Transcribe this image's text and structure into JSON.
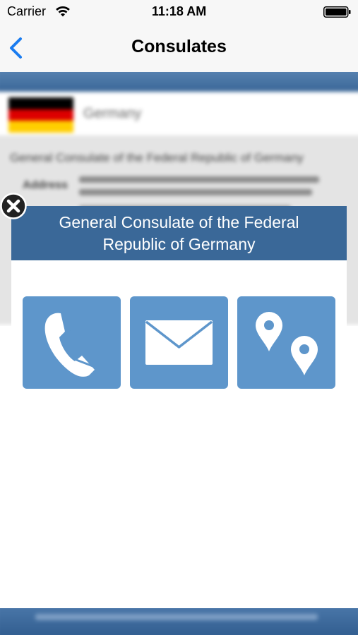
{
  "status_bar": {
    "carrier": "Carrier",
    "time": "11:18 AM",
    "wifi_icon": "wifi-icon",
    "battery_icon": "battery-icon"
  },
  "nav_bar": {
    "back_icon": "chevron-left-icon",
    "title": "Consulates"
  },
  "background": {
    "country_name": "Germany",
    "detail_title": "General Consulate of the Federal Republic of Germany",
    "address_label": "Address"
  },
  "modal": {
    "title": "General Consulate of the Federal Republic of Germany",
    "actions": [
      {
        "name": "call",
        "icon": "phone-icon"
      },
      {
        "name": "email",
        "icon": "mail-icon"
      },
      {
        "name": "map",
        "icon": "map-pins-icon"
      }
    ],
    "close_icon": "close-icon"
  },
  "colors": {
    "accent_blue": "#007aff",
    "modal_header": "#3a6898",
    "action_button": "#5e96cb",
    "header_bar": "#3a6697"
  }
}
